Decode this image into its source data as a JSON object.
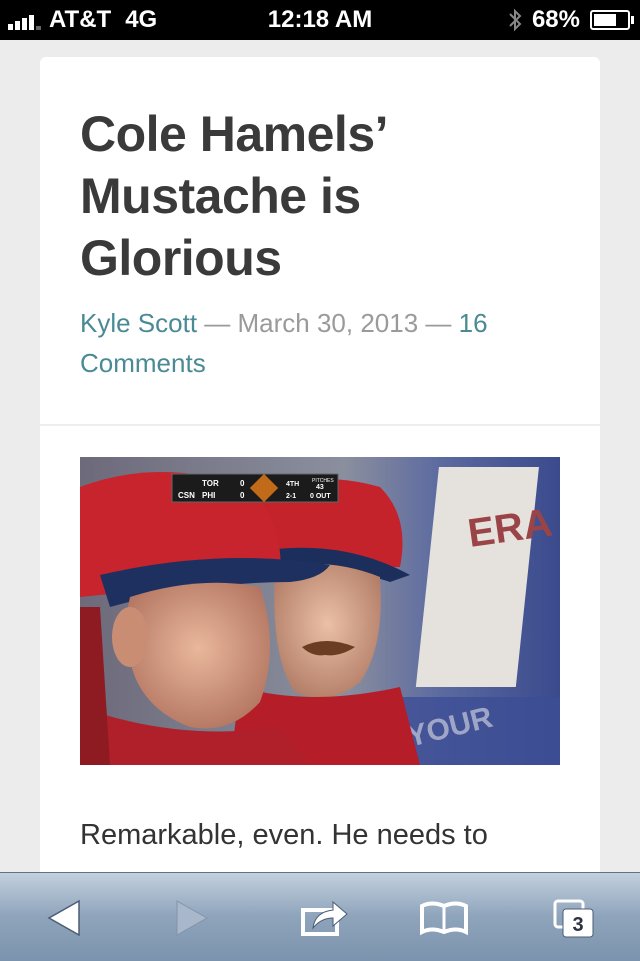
{
  "status_bar": {
    "carrier": "AT&T",
    "network": "4G",
    "time": "12:18 AM",
    "battery": "68%",
    "battery_level": 0.68
  },
  "article": {
    "title": "Cole Hamels’ Mustache is Glorious",
    "author": "Kyle Scott",
    "separator_1": " — ",
    "date": "March 30, 2013",
    "separator_2": " — ",
    "comments": "16 Comments",
    "body": "Remarkable, even. He needs to",
    "scoreboard": {
      "network": "CSN",
      "team_1": "TOR",
      "team_1_score": "0",
      "team_2": "PHI",
      "team_2_score": "0",
      "inning": "4TH",
      "count": "2-1",
      "outs": "0 OUT",
      "pitches_label": "PITCHES",
      "pitches": "43"
    }
  },
  "toolbar": {
    "tabs_count": "3"
  },
  "colors": {
    "link": "#4a8a94",
    "title": "#3a3a3a"
  }
}
